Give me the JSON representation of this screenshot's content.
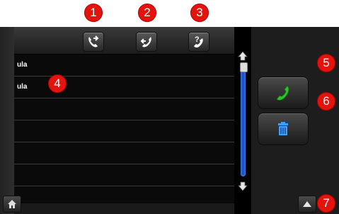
{
  "contacts": [
    {
      "name": "ula"
    },
    {
      "name": "ula"
    }
  ],
  "callouts": [
    "1",
    "2",
    "3",
    "4",
    "5",
    "6",
    "7"
  ],
  "icons": {
    "outgoing": "outgoing-call-icon",
    "incoming": "incoming-call-icon",
    "missed": "missed-call-icon",
    "call": "call-icon",
    "delete": "trash-icon",
    "home": "home-icon",
    "collapse": "chevron-up-icon"
  },
  "colors": {
    "callout": "#e3140e",
    "scrollbar": "#1f56c8",
    "call_green": "#2fbf2f",
    "trash_blue": "#3aa0ff"
  }
}
